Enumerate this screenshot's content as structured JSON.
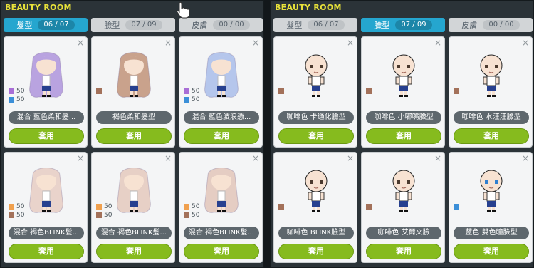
{
  "left": {
    "title": "BEAUTY ROOM",
    "tabs": [
      {
        "label": "髮型",
        "count": "06 / 07"
      },
      {
        "label": "臉型",
        "count": "07 / 09"
      },
      {
        "label": "皮膚",
        "count": "00 / 00"
      }
    ],
    "cards": [
      {
        "name": "混合  藍色柔和髮...",
        "swatches": [
          {
            "color": "#a86ed6",
            "pct": "50"
          },
          {
            "color": "#3b8fd8",
            "pct": "50"
          }
        ],
        "hair": "#b9a3e0",
        "button": "套用"
      },
      {
        "name": "褐色柔和髮型",
        "swatches": [
          {
            "color": "#a3715a",
            "pct": ""
          }
        ],
        "hair": "#c9a28c",
        "button": "套用"
      },
      {
        "name": "混合  藍色波浪憑...",
        "swatches": [
          {
            "color": "#a86ed6",
            "pct": "50"
          },
          {
            "color": "#3b8fd8",
            "pct": "50"
          }
        ],
        "hair": "#b5c6ec",
        "button": "套用"
      },
      {
        "name": "混合  褐色BLINK髮...",
        "swatches": [
          {
            "color": "#f0a04e",
            "pct": "50"
          },
          {
            "color": "#a3715a",
            "pct": "50"
          }
        ],
        "hair": "#e9d3cb",
        "button": "套用"
      },
      {
        "name": "混合  褐色BLINK髮...",
        "swatches": [
          {
            "color": "#f0a04e",
            "pct": "50"
          },
          {
            "color": "#a3715a",
            "pct": "50"
          }
        ],
        "hair": "#e7d0c6",
        "button": "套用"
      },
      {
        "name": "混合  褐色BLINK髮...",
        "swatches": [
          {
            "color": "#f0a04e",
            "pct": "50"
          },
          {
            "color": "#a3715a",
            "pct": "50"
          }
        ],
        "hair": "#e5cdc3",
        "button": "套用"
      }
    ]
  },
  "right": {
    "title": "BEAUTY ROOM",
    "tabs": [
      {
        "label": "髮型",
        "count": "06 / 07"
      },
      {
        "label": "臉型",
        "count": "07 / 09"
      },
      {
        "label": "皮膚",
        "count": "00 / 00"
      }
    ],
    "cards": [
      {
        "name": "咖啡色  卡通化臉型",
        "swatches": [
          {
            "color": "#a3715a",
            "pct": ""
          }
        ],
        "eye": "#4b3a2e",
        "button": "套用"
      },
      {
        "name": "咖啡色  小嘟嘴臉型",
        "swatches": [
          {
            "color": "#a3715a",
            "pct": ""
          }
        ],
        "eye": "#4b3a2e",
        "button": "套用"
      },
      {
        "name": "咖啡色  水汪汪臉型",
        "swatches": [
          {
            "color": "#a3715a",
            "pct": ""
          }
        ],
        "eye": "#4b3a2e",
        "button": "套用"
      },
      {
        "name": "咖啡色  BLINK臉型",
        "swatches": [
          {
            "color": "#a3715a",
            "pct": ""
          }
        ],
        "eye": "#4b3a2e",
        "button": "套用"
      },
      {
        "name": "咖啡色  艾爾文臉",
        "swatches": [
          {
            "color": "#a3715a",
            "pct": ""
          }
        ],
        "eye": "#4b3a2e",
        "button": "套用"
      },
      {
        "name": "藍色  雙色瞳臉型",
        "swatches": [
          {
            "color": "#3b8fd8",
            "pct": ""
          }
        ],
        "eye": "#2f7fd0",
        "button": "套用"
      }
    ]
  },
  "close_glyph": "×",
  "colors": {
    "tab_active": "#25a6cf",
    "apply_button": "#86bb1e",
    "title": "#e8e23a"
  }
}
